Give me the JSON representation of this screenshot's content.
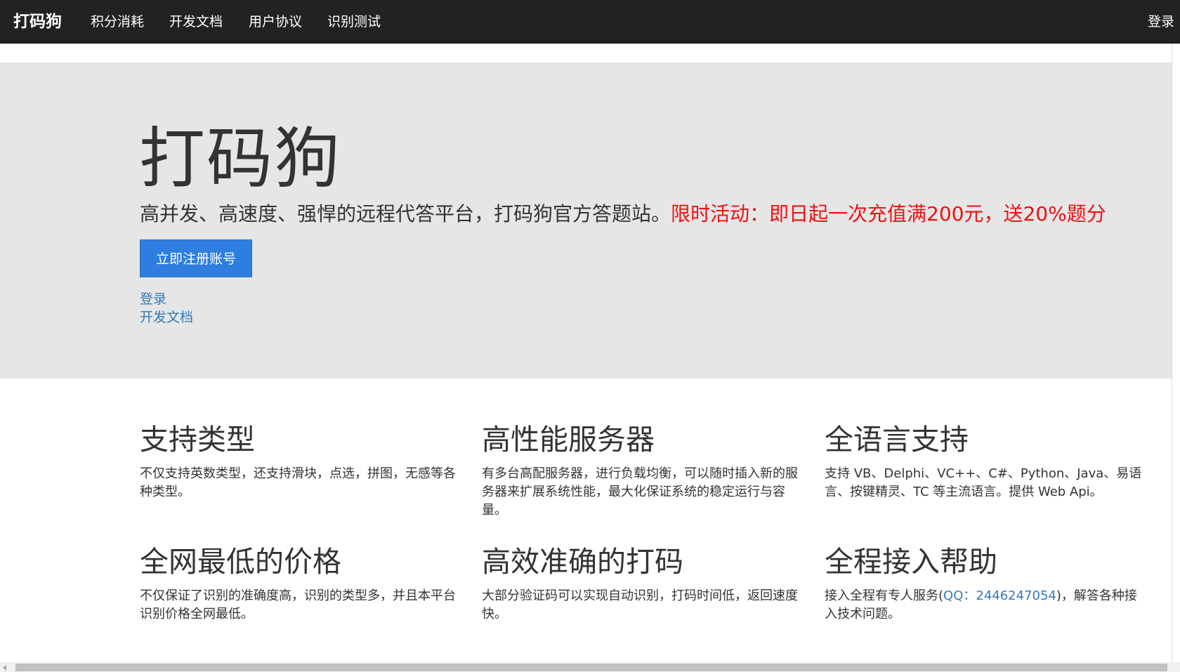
{
  "navbar": {
    "brand": "打码狗",
    "items": [
      {
        "label": "积分消耗"
      },
      {
        "label": "开发文档"
      },
      {
        "label": "用户协议"
      },
      {
        "label": "识别测试"
      }
    ],
    "login": "登录"
  },
  "jumbotron": {
    "title": "打码狗",
    "lead": "高并发、高速度、强悍的远程代答平台，打码狗官方答题站。",
    "promo": "限时活动：即日起一次充值满200元，送20%题分",
    "register_button": "立即注册账号",
    "login_link": "登录",
    "docs_link": "开发文档"
  },
  "features": [
    {
      "title": "支持类型",
      "text": "不仅支持英数类型，还支持滑块，点选，拼图，无感等各种类型。"
    },
    {
      "title": "高性能服务器",
      "text": "有多台高配服务器，进行负载均衡，可以随时插入新的服务器来扩展系统性能，最大化保证系统的稳定运行与容量。"
    },
    {
      "title": "全语言支持",
      "text": "支持 VB、Delphi、VC++、C#、Python、Java、易语言、按键精灵、TC 等主流语言。提供 Web Api。"
    },
    {
      "title": "全网最低的价格",
      "text": "不仅保证了识别的准确度高，识别的类型多，并且本平台识别价格全网最低。"
    },
    {
      "title": "高效准确的打码",
      "text": "大部分验证码可以实现自动识别，打码时间低，返回速度快。"
    },
    {
      "title": "全程接入帮助",
      "text_before": "接入全程有专人服务(",
      "qq": "QQ：2446247054",
      "text_after": ")，解答各种接入技术问题。"
    }
  ],
  "colors": {
    "navbar_bg": "#222222",
    "jumbotron_bg": "#e6e6e6",
    "primary": "#2d7ee0",
    "link": "#337ab7",
    "promo": "#ee1111"
  }
}
